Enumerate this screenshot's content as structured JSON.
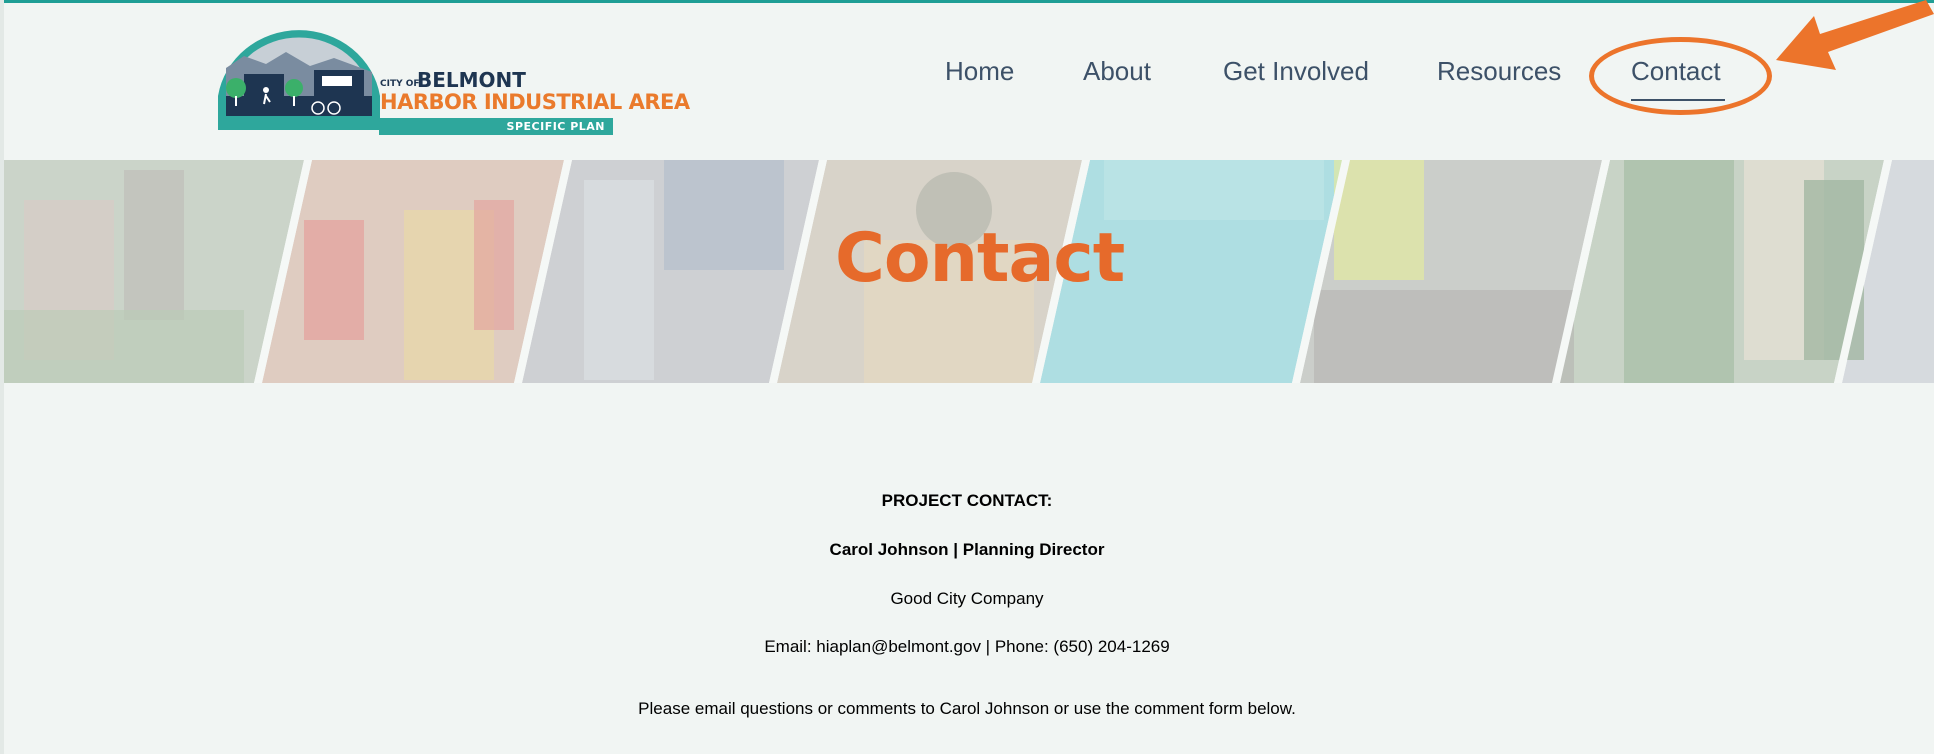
{
  "logo": {
    "city_of": "CITY OF",
    "city_name": "BELMONT",
    "area_name": "HARBOR INDUSTRIAL AREA",
    "plan": "SPECIFIC PLAN"
  },
  "nav": {
    "items": [
      {
        "label": "Home"
      },
      {
        "label": "About"
      },
      {
        "label": "Get Involved"
      },
      {
        "label": "Resources"
      },
      {
        "label": "Contact"
      }
    ],
    "active": "Contact"
  },
  "banner": {
    "title": "Contact"
  },
  "contact": {
    "heading": "PROJECT CONTACT:",
    "person": "Carol Johnson | Planning Director",
    "company": "Good City Company",
    "details": "Email: hiaplan@belmont.gov | Phone: (650) 204-1269",
    "note": "Please email questions or comments to Carol Johnson or use the comment form below."
  },
  "colors": {
    "accent_teal": "#1f9e95",
    "accent_orange": "#ec742b",
    "text_dark": "#27384b",
    "background": "#f1f5f3"
  }
}
